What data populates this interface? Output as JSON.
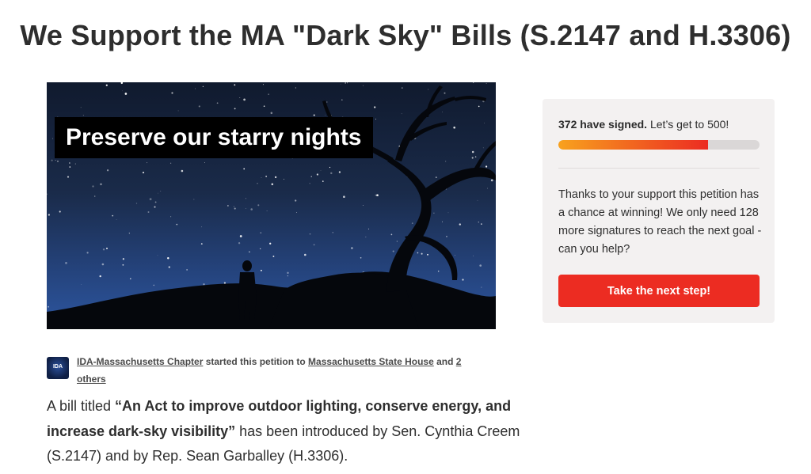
{
  "page": {
    "title": "We Support the MA \"Dark Sky\" Bills (S.2147 and H.3306)"
  },
  "hero": {
    "caption": "Preserve our starry nights"
  },
  "signature_card": {
    "signed_count_text": "372 have signed.",
    "goal_text": " Let’s get to 500!",
    "progress_fraction": 0.744,
    "message": "Thanks to your support this petition has a chance at winning! We only need 128 more signatures to reach the next goal - can you help?",
    "cta_label": "Take the next step!"
  },
  "author": {
    "avatar_text": "IDA",
    "starter": "IDA-Massachusetts Chapter",
    "started_text": " started this petition to ",
    "target": "Massachusetts State House",
    "and_text": " and ",
    "others": "2 others"
  },
  "body": {
    "intro": "A bill titled ",
    "bill_title": "“An Act to improve outdoor lighting, conserve energy, and increase dark-sky visibility”",
    "rest": " has been introduced by Sen. Cynthia Creem (S.2147) and by Rep. Sean Garballey (H.3306)."
  },
  "colors": {
    "accent_red": "#ec2c22",
    "progress_start": "#f8a21e",
    "card_bg": "#f3f1f1"
  }
}
